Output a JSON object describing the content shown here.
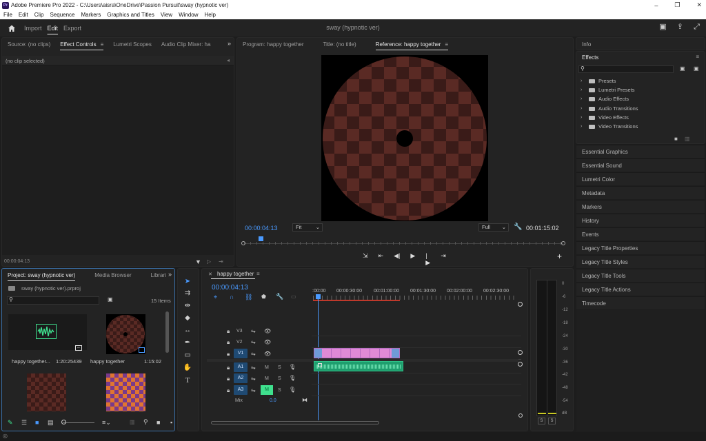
{
  "window": {
    "app_icon": "Pr",
    "title": "Adobe Premiere Pro 2022 - C:\\Users\\aisra\\OneDrive\\Passion Pursuit\\sway (hypnotic ver)",
    "minimize": "–",
    "restore": "❐",
    "close": "✕"
  },
  "menu": [
    "File",
    "Edit",
    "Clip",
    "Sequence",
    "Markers",
    "Graphics and Titles",
    "View",
    "Window",
    "Help"
  ],
  "header": {
    "workspaces": [
      "Import",
      "Edit",
      "Export"
    ],
    "active": "Edit",
    "project_title": "sway (hypnotic ver)"
  },
  "source_panel": {
    "tabs": [
      "Source: (no clips)",
      "Effect Controls",
      "Lumetri Scopes",
      "Audio Clip Mixer: ha"
    ],
    "active_tab": "Effect Controls",
    "clip_state": "(no clip selected)",
    "timecode": "00:00:04:13"
  },
  "program_panel": {
    "tabs": [
      "Program: happy together",
      "Title: (no title)",
      "Reference: happy together"
    ],
    "active_tab": "Reference: happy together",
    "timecode_left": "00:00:04:13",
    "fit": "Fit",
    "quality": "Full",
    "timecode_right": "00:01:15:02"
  },
  "effects_panel": {
    "info_tab": "Info",
    "tab": "Effects",
    "items": [
      "Presets",
      "Lumetri Presets",
      "Audio Effects",
      "Audio Transitions",
      "Video Effects",
      "Video Transitions"
    ],
    "collapsed": [
      "Essential Graphics",
      "Essential Sound",
      "Lumetri Color",
      "Metadata",
      "Markers",
      "History",
      "Events",
      "Legacy Title Properties",
      "Legacy Title Styles",
      "Legacy Title Tools",
      "Legacy Title Actions",
      "Timecode"
    ]
  },
  "project_panel": {
    "tabs": [
      "Project: sway (hypnotic ver)",
      "Media Browser",
      "Librari"
    ],
    "file": "sway (hypnotic ver).prproj",
    "count": "15 Items",
    "items": [
      {
        "name": "happy together...",
        "duration": "1:20:25439"
      },
      {
        "name": "happy together",
        "duration": "1:15:02"
      }
    ]
  },
  "timeline": {
    "tab": "happy together",
    "timecode": "00:00:04:13",
    "ruler": [
      ":00:00",
      "00:00:30:00",
      "00:01:00:00",
      "00:01:30:00",
      "00:02:00:00",
      "00:02:30:00"
    ],
    "video_tracks": [
      "V3",
      "V2",
      "V1"
    ],
    "audio_tracks": [
      "A1",
      "A2",
      "A3"
    ],
    "mix_label": "Mix",
    "mix_value": "0.0",
    "m": "M",
    "s": "S"
  },
  "meter": {
    "scale": [
      "0",
      "-6",
      "-12",
      "-18",
      "-24",
      "-30",
      "-36",
      "-42",
      "-48",
      "-54",
      "dB"
    ],
    "solo": [
      "S",
      "S"
    ]
  }
}
